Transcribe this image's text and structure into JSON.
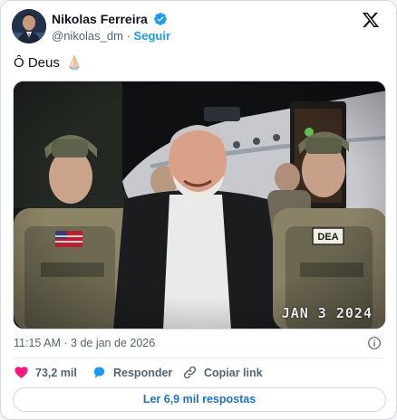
{
  "author": {
    "display_name": "Nikolas Ferreira",
    "handle": "@nikolas_dm",
    "separator": "·",
    "follow_label": "Seguir",
    "verified": true,
    "avatar_icon": "user-avatar"
  },
  "tweet": {
    "text": "Ô Deus",
    "emoji": "folded-hands",
    "media": {
      "timestamp_overlay": "JAN  3 2024",
      "vest_label": "DEA"
    },
    "time": "11:15 AM",
    "meta_separator": "·",
    "date": "3 de jan de 2026"
  },
  "actions": {
    "likes": "73,2 mil",
    "reply_label": "Responder",
    "copy_label": "Copiar link"
  },
  "footer": {
    "read_replies_label": "Ler 6,9 mil respostas"
  },
  "colors": {
    "accent": "#1d9bf0",
    "like": "#f91880",
    "secondary_text": "#536471",
    "border": "#cfd9de"
  }
}
